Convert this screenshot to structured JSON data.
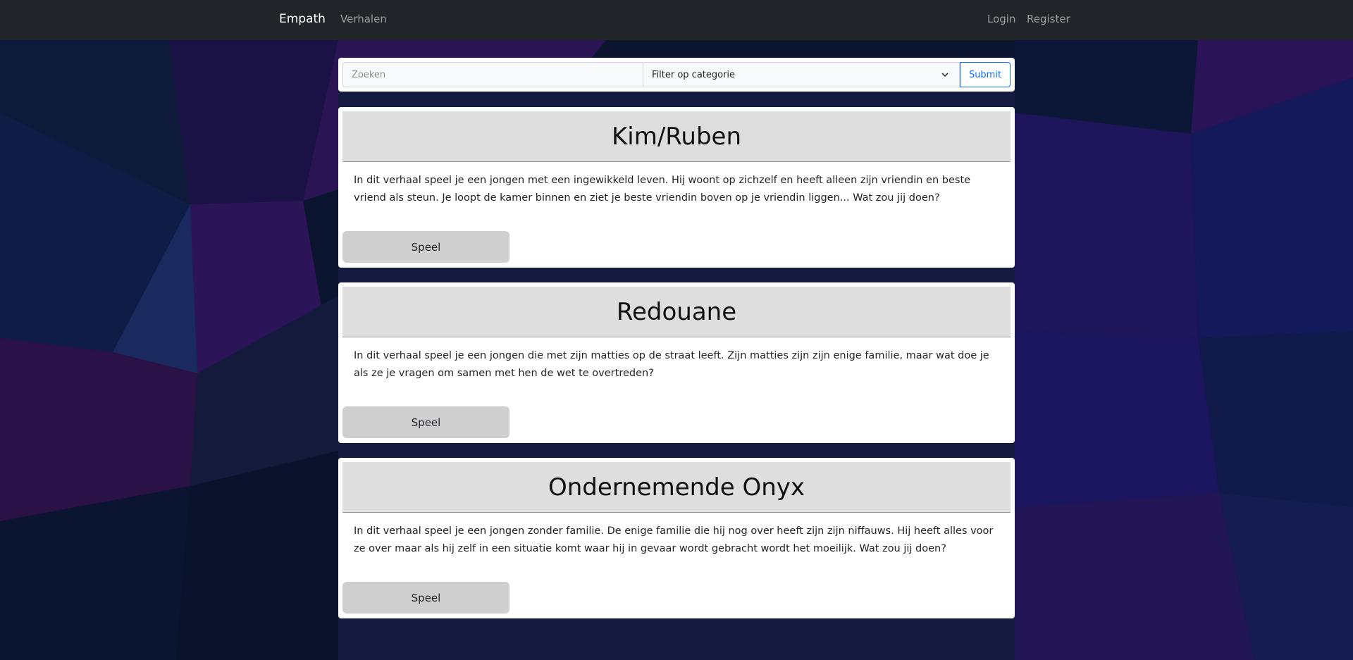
{
  "navbar": {
    "brand": "Empath",
    "links": [
      "Verhalen"
    ],
    "right_links": [
      "Login",
      "Register"
    ]
  },
  "search": {
    "placeholder": "Zoeken",
    "value": "",
    "category_selected": "Filter op categorie",
    "submit_label": "Submit"
  },
  "stories": [
    {
      "title": "Kim/Ruben",
      "description": "In dit verhaal speel je een jongen met een ingewikkeld leven. Hij woont op zichzelf en heeft alleen zijn vriendin en beste vriend als steun. Je loopt de kamer binnen en ziet je beste vriendin boven op je vriendin liggen... Wat zou jij doen?",
      "button_label": "Speel"
    },
    {
      "title": "Redouane",
      "description": "In dit verhaal speel je een jongen die met zijn matties op de straat leeft. Zijn matties zijn zijn enige familie, maar wat doe je als ze je vragen om samen met hen de wet te overtreden?",
      "button_label": "Speel"
    },
    {
      "title": "Ondernemende Onyx",
      "description": "In dit verhaal speel je een jongen zonder familie. De enige familie die hij nog over heeft zijn zijn niffauws. Hij heeft alles voor ze over maar als hij zelf in een situatie komt waar hij in gevaar wordt gebracht wordt het moeilijk. Wat zou jij doen?",
      "button_label": "Speel"
    }
  ],
  "colors": {
    "navbar_bg": "#212529",
    "submit_accent": "#0d6efd",
    "card_header_bg": "#dedede",
    "play_button_bg": "#cfcfcf"
  }
}
